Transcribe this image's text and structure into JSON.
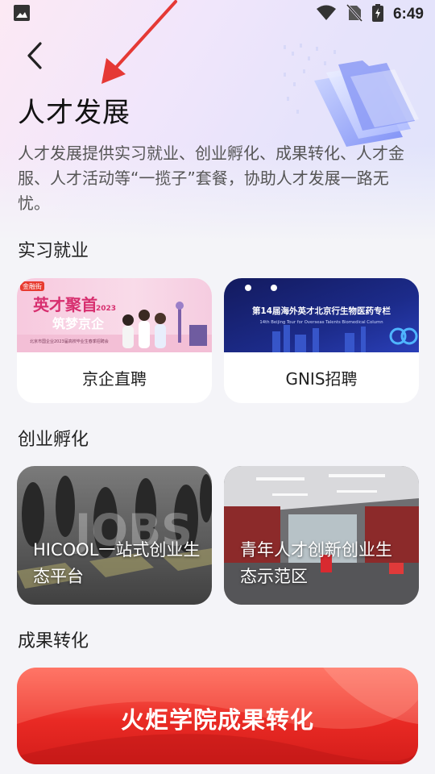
{
  "status_bar": {
    "time": "6:49"
  },
  "header": {
    "title": "人才发展",
    "description": "人才发展提供实习就业、创业孵化、成果转化、人才金服、人才活动等“一揽子”套餐，协助人才发展一路无忧。"
  },
  "sections": {
    "internship": {
      "title": "实习就业",
      "cards": [
        {
          "label": "京企直聘",
          "banner_text_main": "英才聚首",
          "banner_text_sub": "筑梦京企",
          "banner_badge": "金融街",
          "banner_year": "2023",
          "banner_caption": "北京市国企业2023届高校毕业生春季招聘会"
        },
        {
          "label": "GNIS招聘",
          "banner_text_main": "第14届海外英才北京行生物医药专栏",
          "banner_caption": "14th Beijing Tour for Overseas Talents Biomedical Column"
        }
      ]
    },
    "incubation": {
      "title": "创业孵化",
      "cards": [
        {
          "label": "HICOOL一站式创业生态平台",
          "photo_text": "JOBS"
        },
        {
          "label": "青年人才创新创业生态示范区"
        }
      ]
    },
    "achievement": {
      "title": "成果转化",
      "banner_label": "火炬学院成果转化"
    }
  },
  "colors": {
    "accent_red": "#e92a24",
    "annotation_red": "#e53935",
    "gnis_navy": "#1a1f6e",
    "jingqi_pink": "#f9d2e4"
  }
}
